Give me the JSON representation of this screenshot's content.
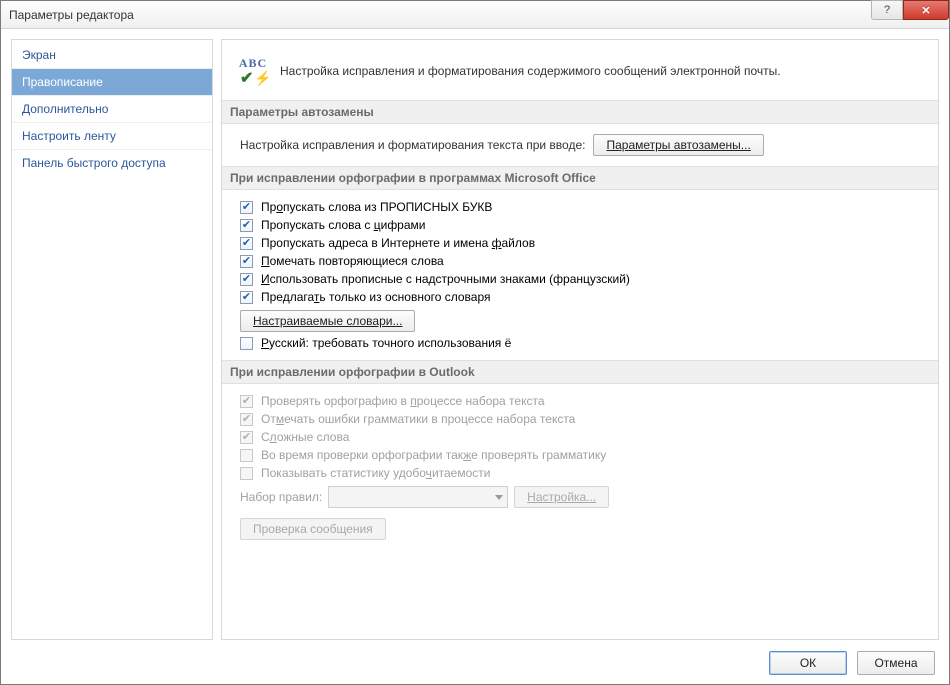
{
  "window": {
    "title": "Параметры редактора"
  },
  "sidebar": {
    "items": [
      {
        "label": "Экран",
        "selected": false
      },
      {
        "label": "Правописание",
        "selected": true
      },
      {
        "label": "Дополнительно",
        "selected": false
      },
      {
        "label": "Настроить ленту",
        "selected": false
      },
      {
        "label": "Панель быстрого доступа",
        "selected": false
      }
    ]
  },
  "intro": {
    "icon_text": "ABC",
    "text": "Настройка исправления и форматирования содержимого сообщений электронной почты."
  },
  "sections": {
    "autocorrect": {
      "title": "Параметры автозамены",
      "row_label": "Настройка исправления и форматирования текста при вводе:",
      "button": "Параметры автозамены..."
    },
    "office_spell": {
      "title": "При исправлении орфографии в программах Microsoft Office",
      "items": [
        {
          "checked": true,
          "label_pre": "Пр",
          "u": "о",
          "label_post": "пускать слова из ПРОПИСНЫХ БУКВ"
        },
        {
          "checked": true,
          "label_pre": "Пропускать слова с ",
          "u": "ц",
          "label_post": "ифрами"
        },
        {
          "checked": true,
          "label_pre": "Пропускать адреса в Интернете и имена ",
          "u": "ф",
          "label_post": "айлов"
        },
        {
          "checked": true,
          "label_pre": "",
          "u": "П",
          "label_post": "омечать повторяющиеся слова"
        },
        {
          "checked": true,
          "label_pre": "",
          "u": "И",
          "label_post": "спользовать прописные с надстрочными знаками (французский)"
        },
        {
          "checked": true,
          "label_pre": "Предлага",
          "u": "т",
          "label_post": "ь только из основного словаря"
        }
      ],
      "dict_button": "Настраиваемые словари...",
      "russian_yo": {
        "checked": false,
        "label_pre": "",
        "u": "Р",
        "label_post": "усский: требовать точного использования ё"
      }
    },
    "outlook_spell": {
      "title": "При исправлении орфографии в Outlook",
      "items": [
        {
          "checked": true,
          "disabled": true,
          "label_pre": "Проверять орфографию в ",
          "u": "п",
          "label_post": "роцессе набора текста"
        },
        {
          "checked": true,
          "disabled": true,
          "label_pre": "От",
          "u": "м",
          "label_post": "ечать ошибки грамматики в процессе набора текста"
        },
        {
          "checked": true,
          "disabled": true,
          "label_pre": "С",
          "u": "л",
          "label_post": "ожные слова"
        },
        {
          "checked": false,
          "disabled": true,
          "label_pre": "Во время проверки орфографии так",
          "u": "ж",
          "label_post": "е проверять грамматику"
        },
        {
          "checked": false,
          "disabled": true,
          "label_pre": "Показывать статистику удобо",
          "u": "ч",
          "label_post": "итаемости"
        }
      ],
      "ruleset_label": "Набор правил:",
      "ruleset_value": "",
      "settings_button": "Настройка...",
      "recheck_button": "Проверка сообщения"
    }
  },
  "footer": {
    "ok": "ОК",
    "cancel": "Отмена"
  },
  "winbuttons": {
    "help": "?",
    "close": "✕"
  }
}
